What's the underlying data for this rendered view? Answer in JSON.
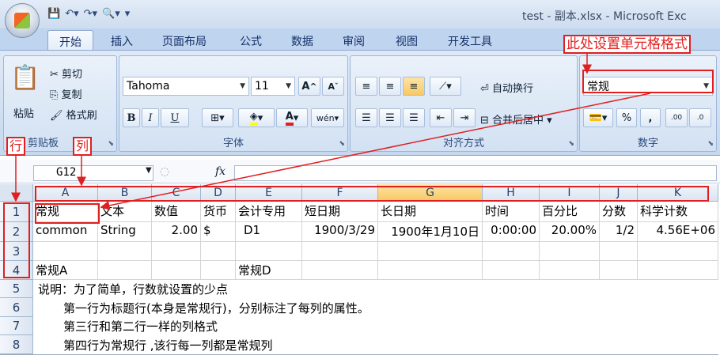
{
  "window": {
    "title": "test - 副本.xlsx - Microsoft Exc"
  },
  "tabs": [
    "开始",
    "插入",
    "页面布局",
    "公式",
    "数据",
    "审阅",
    "视图",
    "开发工具"
  ],
  "ribbon": {
    "clipboard": {
      "paste": "粘贴",
      "cut": "剪切",
      "copy": "复制",
      "format_painter": "格式刷",
      "label": "剪贴板"
    },
    "font": {
      "name": "Tahoma",
      "size": "11",
      "label": "字体",
      "bold": "B",
      "italic": "I",
      "underline": "U",
      "grow": "A",
      "shrink": "A",
      "font_color": "A",
      "phonetic": "wén"
    },
    "alignment": {
      "wrap": "自动换行",
      "merge": "合并后居中",
      "label": "对齐方式"
    },
    "number": {
      "format": "常规",
      "label": "数字",
      "percent": "%",
      "comma": ",",
      "inc_decimal": ".00",
      "dec_decimal": ".0"
    }
  },
  "formula_bar": {
    "name_box": "G12",
    "fx": "fx"
  },
  "columns": [
    "A",
    "B",
    "C",
    "D",
    "E",
    "F",
    "G",
    "H",
    "I",
    "J",
    "K"
  ],
  "rows": [
    "1",
    "2",
    "3",
    "4",
    "5",
    "6",
    "7",
    "8"
  ],
  "cells": {
    "row1": [
      "常规",
      "文本",
      "数值",
      "货币",
      "会计专用",
      "短日期",
      "长日期",
      "时间",
      "百分比",
      "分数",
      "科学计数"
    ],
    "row2": [
      "common",
      "String",
      "2.00",
      "$",
      "D1",
      "1900/3/29",
      "1900年1月10日",
      "0:00:00",
      "20.00%",
      "1/2",
      "4.56E+06"
    ],
    "row4a": "常规A",
    "row4e": "常规D",
    "row5": "说明：为了简单，行数就设置的少点",
    "row6": "第一行为标题行(本身是常规行)，分别标注了每列的属性。",
    "row7": "第三行和第二行一样的列格式",
    "row8": "第四行为常规行 ,该行每一列都是常规列"
  },
  "annotations": {
    "format_hint": "此处设置单元格格式",
    "row_label": "行",
    "col_label": "列"
  },
  "colors": {
    "annotation": "#e02020",
    "selected_col": "#f8c863"
  }
}
